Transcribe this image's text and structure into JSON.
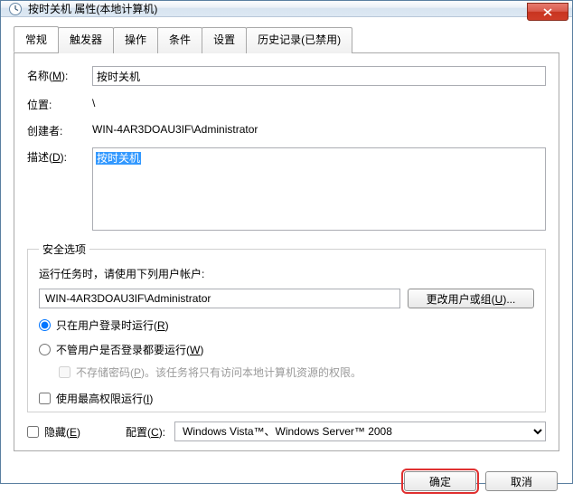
{
  "window": {
    "title": "按时关机 属性(本地计算机)"
  },
  "tabs": [
    "常规",
    "触发器",
    "操作",
    "条件",
    "设置",
    "历史记录(已禁用)"
  ],
  "general": {
    "name_label_pre": "名称(",
    "name_label_u": "M",
    "name_label_post": "):",
    "name_value": "按时关机",
    "location_label": "位置:",
    "location_value": "\\",
    "creator_label": "创建者:",
    "creator_value": "WIN-4AR3DOAU3IF\\Administrator",
    "desc_label_pre": "描述(",
    "desc_label_u": "D",
    "desc_label_post": "):",
    "desc_value": "按时关机"
  },
  "security": {
    "legend": "安全选项",
    "run_as_text": "运行任务时，请使用下列用户帐户:",
    "account": "WIN-4AR3DOAU3IF\\Administrator",
    "change_btn_pre": "更改用户或组(",
    "change_btn_u": "U",
    "change_btn_post": ")...",
    "radio1_pre": "只在用户登录时运行(",
    "radio1_u": "R",
    "radio1_post": ")",
    "radio2_pre": "不管用户是否登录都要运行(",
    "radio2_u": "W",
    "radio2_post": ")",
    "store_pwd_pre": "不存储密码(",
    "store_pwd_u": "P",
    "store_pwd_post": ")。该任务将只有访问本地计算机资源的权限。",
    "highest_pre": "使用最高权限运行(",
    "highest_u": "I",
    "highest_post": ")"
  },
  "bottom": {
    "hidden_pre": "隐藏(",
    "hidden_u": "E",
    "hidden_post": ")",
    "config_pre": "配置(",
    "config_u": "C",
    "config_post": "):",
    "config_value": "Windows Vista™、Windows Server™ 2008"
  },
  "footer": {
    "ok": "确定",
    "cancel": "取消"
  }
}
